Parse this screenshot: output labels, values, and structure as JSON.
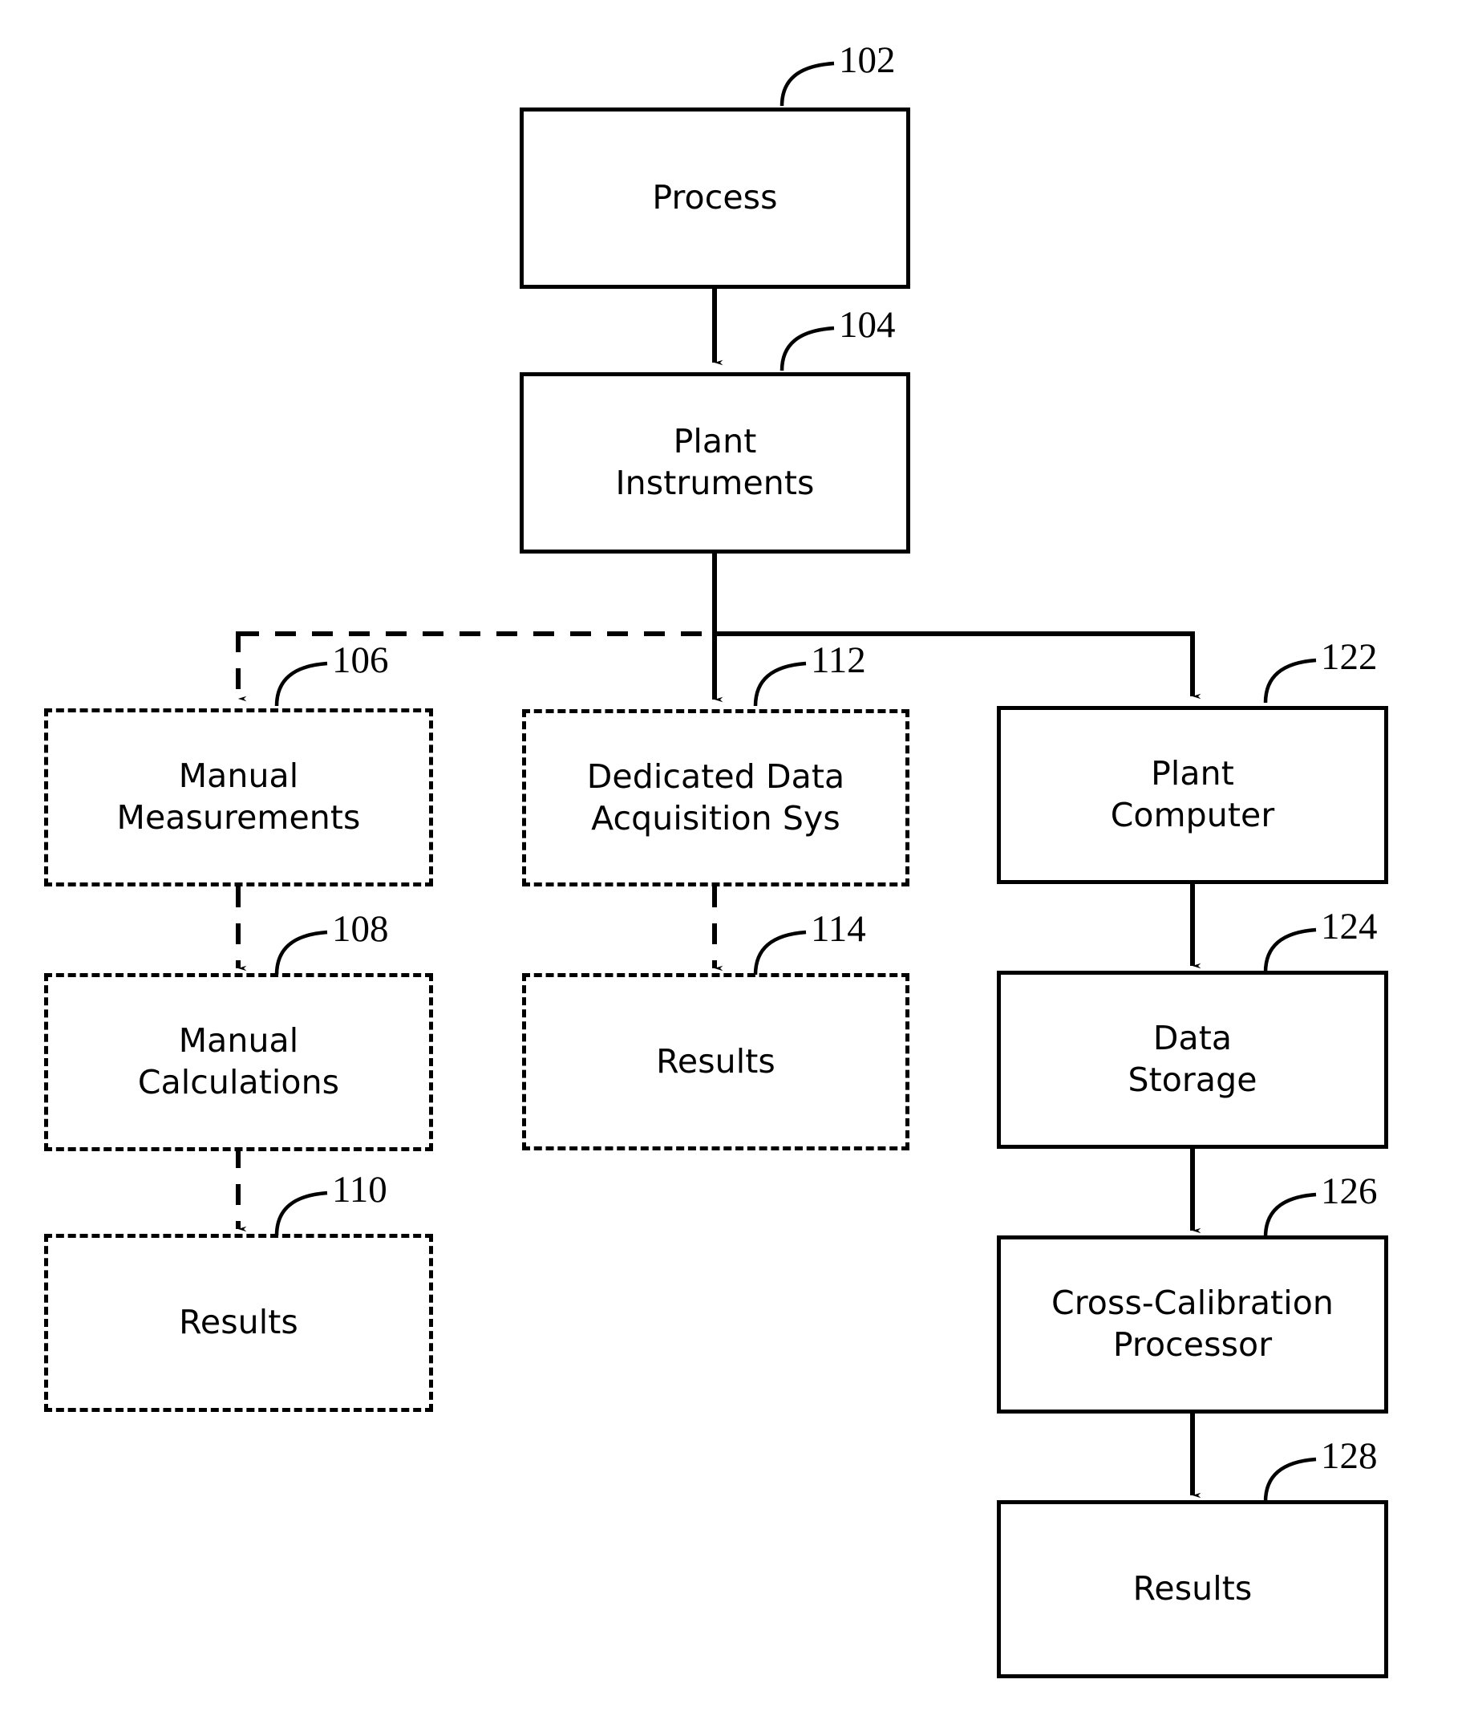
{
  "figure": {
    "type": "patent-block-diagram",
    "line_color": "#000000",
    "background_color": "#ffffff"
  },
  "nodes": [
    {
      "id": "process",
      "label": "Process",
      "ref": "102",
      "style": "solid",
      "column": "center-top"
    },
    {
      "id": "plant-instruments",
      "label": "Plant\nInstruments",
      "ref": "104",
      "style": "solid",
      "column": "center-top"
    },
    {
      "id": "manual-measurements",
      "label": "Manual\nMeasurements",
      "ref": "106",
      "style": "dashed",
      "column": "left"
    },
    {
      "id": "manual-calculations",
      "label": "Manual\nCalculations",
      "ref": "108",
      "style": "dashed",
      "column": "left"
    },
    {
      "id": "manual-results",
      "label": "Results",
      "ref": "110",
      "style": "dashed",
      "column": "left"
    },
    {
      "id": "dedicated-data-acquisition-sys",
      "label": "Dedicated Data\nAcquisition Sys",
      "ref": "112",
      "style": "dashed",
      "column": "middle"
    },
    {
      "id": "dedicated-results",
      "label": "Results",
      "ref": "114",
      "style": "dashed",
      "column": "middle"
    },
    {
      "id": "plant-computer",
      "label": "Plant\nComputer",
      "ref": "122",
      "style": "solid",
      "column": "right"
    },
    {
      "id": "data-storage",
      "label": "Data\nStorage",
      "ref": "124",
      "style": "solid",
      "column": "right"
    },
    {
      "id": "cross-calibration-processor",
      "label": "Cross-Calibration\nProcessor",
      "ref": "126",
      "style": "solid",
      "column": "right"
    },
    {
      "id": "plant-results",
      "label": "Results",
      "ref": "128",
      "style": "solid",
      "column": "right"
    }
  ],
  "edges": [
    {
      "from": "process",
      "to": "plant-instruments",
      "style": "solid",
      "arrow": true
    },
    {
      "from": "plant-instruments",
      "to": "manual-measurements",
      "style": "dashed",
      "arrow": true
    },
    {
      "from": "plant-instruments",
      "to": "dedicated-data-acquisition-sys",
      "style": "solid",
      "arrow": true
    },
    {
      "from": "plant-instruments",
      "to": "plant-computer",
      "style": "solid",
      "arrow": true
    },
    {
      "from": "manual-measurements",
      "to": "manual-calculations",
      "style": "dashed",
      "arrow": true
    },
    {
      "from": "manual-calculations",
      "to": "manual-results",
      "style": "dashed",
      "arrow": true
    },
    {
      "from": "dedicated-data-acquisition-sys",
      "to": "dedicated-results",
      "style": "dashed",
      "arrow": true
    },
    {
      "from": "plant-computer",
      "to": "data-storage",
      "style": "solid",
      "arrow": true
    },
    {
      "from": "data-storage",
      "to": "cross-calibration-processor",
      "style": "solid",
      "arrow": true
    },
    {
      "from": "cross-calibration-processor",
      "to": "plant-results",
      "style": "solid",
      "arrow": true
    }
  ]
}
